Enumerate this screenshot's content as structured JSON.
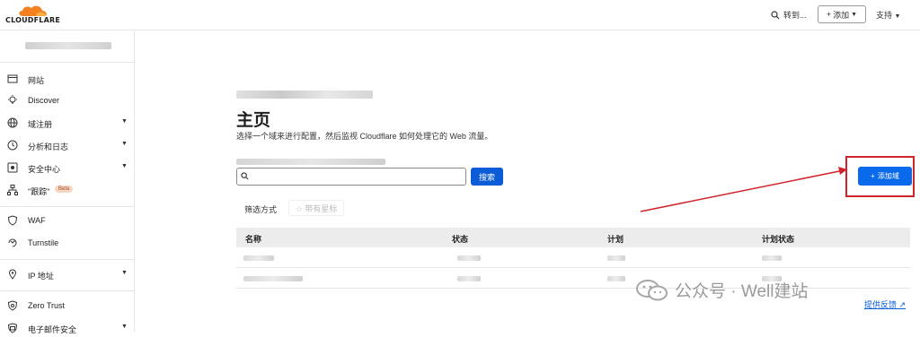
{
  "topbar": {
    "brand": "CLOUDFLARE",
    "goto_label": "转到...",
    "add_label": "添加",
    "support_label": "支持"
  },
  "sidebar": {
    "items": [
      {
        "label": "网站",
        "icon": "browser-window-icon"
      },
      {
        "label": "Discover",
        "icon": "lightbulb-icon"
      },
      {
        "label": "域注册",
        "icon": "globe-icon",
        "has_submenu": true
      },
      {
        "label": "分析和日志",
        "icon": "clock-chart-icon",
        "has_submenu": true
      },
      {
        "label": "安全中心",
        "icon": "security-center-icon",
        "has_submenu": true
      },
      {
        "label": "\"跟踪\"",
        "icon": "sitemap-icon",
        "badge": "Beta"
      },
      {
        "label": "WAF",
        "icon": "shield-icon"
      },
      {
        "label": "Turnstile",
        "icon": "turnstile-icon"
      },
      {
        "label": "IP 地址",
        "icon": "location-pin-icon",
        "has_submenu": true
      },
      {
        "label": "Zero Trust",
        "icon": "zero-trust-icon"
      },
      {
        "label": "电子邮件安全",
        "icon": "email-security-icon",
        "has_submenu": true
      }
    ]
  },
  "main": {
    "title": "主页",
    "description": "选择一个域来进行配置，然后监视 Cloudflare 如何处理它的 Web 流量。",
    "search_button": "搜索",
    "add_domain_button": "添加域",
    "filter_label": "筛选方式",
    "starred_filter": "☆ 带有星标",
    "table": {
      "columns": [
        "名称",
        "状态",
        "计划",
        "计划状态"
      ]
    },
    "feedback_link": "提供反馈"
  },
  "watermark": {
    "text": "公众号 · Well建站"
  },
  "colors": {
    "accent": "#0b6aeb",
    "highlight": "#d0242a",
    "logo_orange": "#f48120"
  }
}
